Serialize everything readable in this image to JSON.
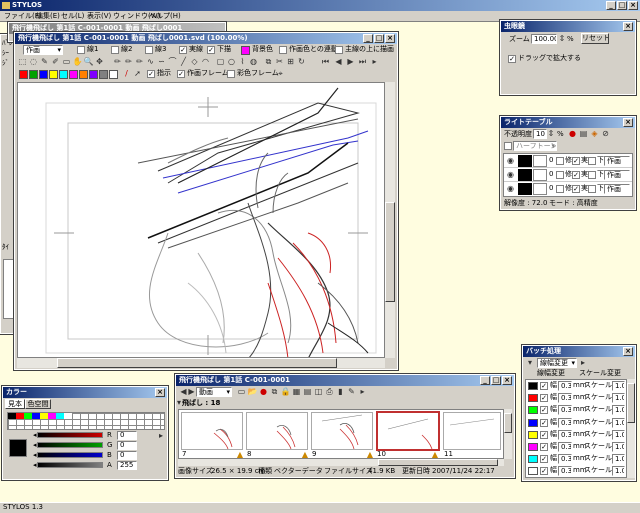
{
  "app": {
    "title": "STYLOS",
    "status": "STYLOS 1.3"
  },
  "menu": [
    "ファイル(F)",
    "編集(E)",
    "セル(L)",
    "表示(V)",
    "ウィンドウ(W)",
    "ヘルプ(H)"
  ],
  "window_controls": {
    "min": "_",
    "max": "□",
    "close": "×"
  },
  "canvas_window": {
    "title": "飛行機飛ばし 第1話 C-001-0001 動画 飛ばし0001.svd (100.00%)",
    "back_title": "飛行機飛ばし 第1話 C-001-0001 動画 飛ばし0001",
    "layer_select": "作画",
    "layers": [
      "線1",
      "線2",
      "線3"
    ],
    "toggles": [
      "実線",
      "下描"
    ],
    "bg_label": "背景色",
    "sync_label": "作画色との連動",
    "draw_over_label": "主線の上に描画",
    "row3": [
      "指示",
      "作画フレーム",
      "彩色フレーム"
    ],
    "swatch_colors": [
      "#ff0000",
      "#00a000",
      "#0000ff",
      "#ffff00",
      "#00ffff",
      "#ff00ff",
      "#ff8000",
      "#8000ff",
      "#808080",
      "#ffffff"
    ]
  },
  "magnifier": {
    "title": "虫眼鏡",
    "zoom_label": "ズーム",
    "zoom_value": "100.00",
    "unit": "%",
    "reset": "リセット",
    "drag_label": "ドラッグで拡大する"
  },
  "lighttable": {
    "title": "ライトテーブル",
    "opacity_label": "不透明度",
    "opacity_value": "10",
    "unit": "%",
    "halftone": "ハーフトーン",
    "rows": [
      {
        "n": "0",
        "opts": [
          "修",
          "実",
          "下"
        ],
        "sel": "作画"
      },
      {
        "n": "0",
        "opts": [
          "修",
          "実",
          "下"
        ],
        "sel": "作画"
      },
      {
        "n": "0",
        "opts": [
          "修",
          "実",
          "下"
        ],
        "sel": "作画"
      }
    ],
    "res_label": "解像度 : 72.0",
    "mode_label": "モード : 高精度"
  },
  "timeline": {
    "title": "飛行機飛ばし 第1話 C-001-0001",
    "select": "動画",
    "group": "飛ばし : 18",
    "frames": [
      "7",
      "8",
      "9",
      "10",
      "11"
    ],
    "info": {
      "size_label": "画像サイズ",
      "size": "26.5 × 19.9 cm",
      "type_label": "種類",
      "type": "ベクターデータ",
      "file_label": "ファイルサイズ",
      "file": "41.9 KB",
      "date_label": "更新日時",
      "date": "2007/11/24 22:17"
    }
  },
  "batch": {
    "title": "バッチ処理",
    "select": "線幅変更",
    "col1": "線幅変更",
    "col2": "スケール変更",
    "rows": [
      {
        "color": "#000000",
        "w": "0.3",
        "s": "1.0"
      },
      {
        "color": "#ff0000",
        "w": "0.3",
        "s": "1.0"
      },
      {
        "color": "#00ff00",
        "w": "0.3",
        "s": "1.0"
      },
      {
        "color": "#0000ff",
        "w": "0.3",
        "s": "1.0"
      },
      {
        "color": "#ffff00",
        "w": "0.3",
        "s": "1.0"
      },
      {
        "color": "#ff00ff",
        "w": "0.3",
        "s": "1.0"
      },
      {
        "color": "#00ffff",
        "w": "0.3",
        "s": "1.0"
      },
      {
        "color": "#ffffff",
        "w": "0.3",
        "s": "1.0"
      }
    ],
    "w_label": "幅",
    "mm": "mm",
    "scale_label": "スケール"
  },
  "color": {
    "title": "カラー",
    "tabs": [
      "見本",
      "色空間"
    ],
    "sliders": [
      {
        "label": "R",
        "value": "0",
        "color": "#cc0000"
      },
      {
        "label": "G",
        "value": "0",
        "color": "#00a000"
      },
      {
        "label": "B",
        "value": "0",
        "color": "#0000cc"
      },
      {
        "label": "A",
        "value": "255",
        "color": "#808080"
      }
    ],
    "palette_top": [
      "#000000",
      "#ff0000",
      "#00ff00",
      "#0000ff",
      "#ffff00",
      "#ff00ff",
      "#00ffff",
      "#ffffff"
    ]
  },
  "left_panel": {
    "labels": [
      "ﾊﾞﾚ",
      "ｼｰ",
      "ｼﾞ",
      "ﾀｲ"
    ]
  }
}
